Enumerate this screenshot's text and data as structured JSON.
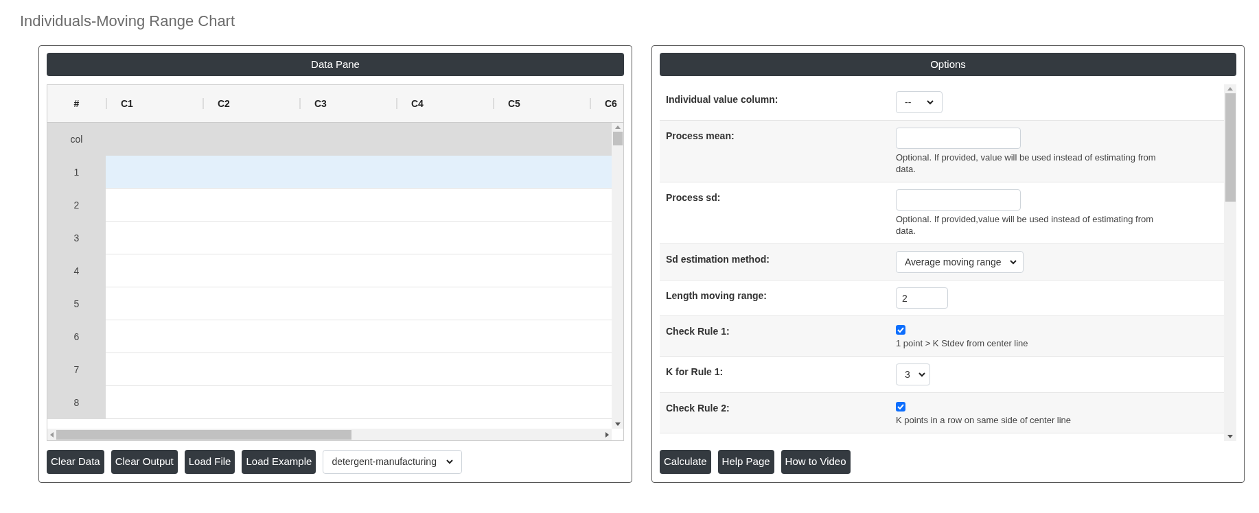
{
  "title": "Individuals-Moving Range Chart",
  "data_pane": {
    "header": "Data Pane",
    "columns": [
      "#",
      "C1",
      "C2",
      "C3",
      "C4",
      "C5",
      "C6"
    ],
    "header_row_label": "col",
    "rows": [
      {
        "number": "1",
        "selected": true
      },
      {
        "number": "2",
        "selected": false
      },
      {
        "number": "3",
        "selected": false
      },
      {
        "number": "4",
        "selected": false
      },
      {
        "number": "5",
        "selected": false
      },
      {
        "number": "6",
        "selected": false
      },
      {
        "number": "7",
        "selected": false
      },
      {
        "number": "8",
        "selected": false
      }
    ],
    "buttons": [
      "Clear Data",
      "Clear Output",
      "Load File",
      "Load Example"
    ],
    "example_select": "detergent-manufacturing"
  },
  "options": {
    "header": "Options",
    "fields": [
      {
        "kind": "select",
        "label": "Individual value column:",
        "value": "--"
      },
      {
        "kind": "input",
        "label": "Process mean:",
        "help": "Optional. If provided, value will be used instead of estimating from data."
      },
      {
        "kind": "input",
        "label": "Process sd:",
        "help": "Optional. If provided,value will be used instead of estimating from data."
      },
      {
        "kind": "select",
        "label": "Sd estimation method:",
        "value": "Average moving range"
      },
      {
        "kind": "number",
        "label": "Length moving range:",
        "value": "2"
      },
      {
        "kind": "checkbox",
        "label": "Check Rule 1:",
        "checked": true,
        "help": "1 point > K Stdev from center line"
      },
      {
        "kind": "select",
        "label": "K for Rule 1:",
        "value": "3"
      },
      {
        "kind": "checkbox",
        "label": "Check Rule 2:",
        "checked": true,
        "help": "K points in a row on same side of center line"
      }
    ],
    "buttons": [
      "Calculate",
      "Help Page",
      "How to Video"
    ]
  }
}
